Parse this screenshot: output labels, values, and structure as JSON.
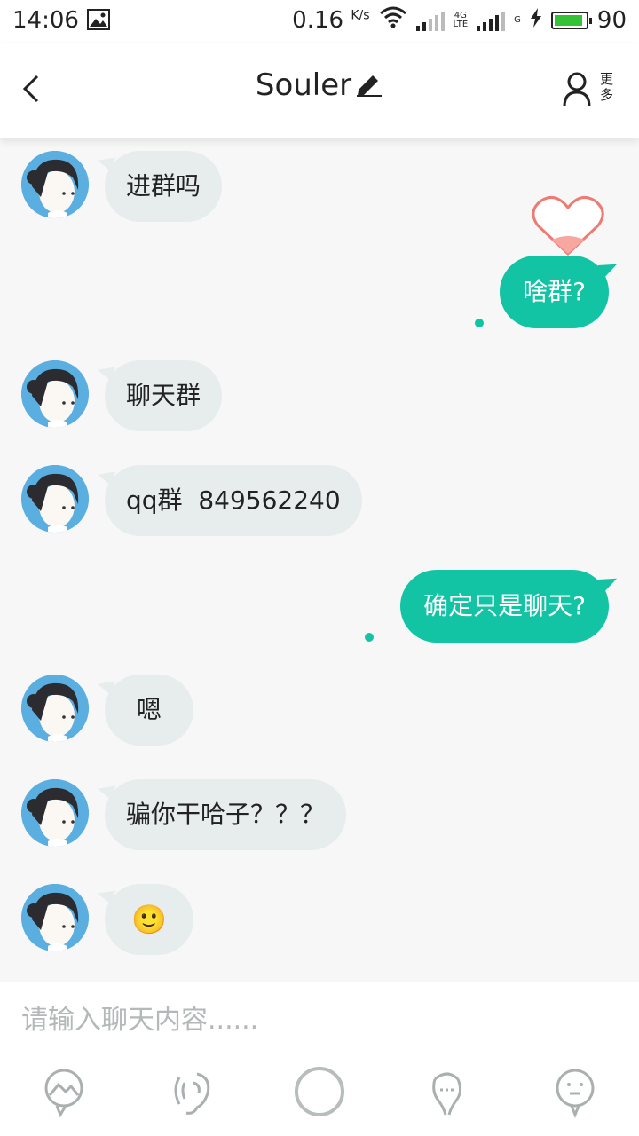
{
  "status": {
    "time": "14:06",
    "speed": "0.16",
    "speed_unit": "K/s",
    "net1": "4G",
    "net1_sub": "LTE",
    "net2": "G",
    "battery": "90"
  },
  "header": {
    "title": "Souler",
    "more_label": "更多"
  },
  "messages": [
    {
      "side": "in",
      "text": "进群吗"
    },
    {
      "side": "out",
      "text": "啥群?"
    },
    {
      "side": "in",
      "text": "聊天群"
    },
    {
      "side": "in",
      "text": "qq群  849562240"
    },
    {
      "side": "out",
      "text": "确定只是聊天?"
    },
    {
      "side": "in",
      "text": "嗯"
    },
    {
      "side": "in",
      "text": "骗你干哈子？？？"
    },
    {
      "side": "in",
      "text": "🙂"
    }
  ],
  "input": {
    "placeholder": "请输入聊天内容......"
  },
  "toolbar_icons": [
    "image-icon",
    "voice-icon",
    "record-circle-icon",
    "call-icon",
    "emoji-icon"
  ],
  "colors": {
    "accent": "#12c3a4",
    "incoming_bubble": "#e7ecec",
    "background": "#f6f7f6"
  }
}
